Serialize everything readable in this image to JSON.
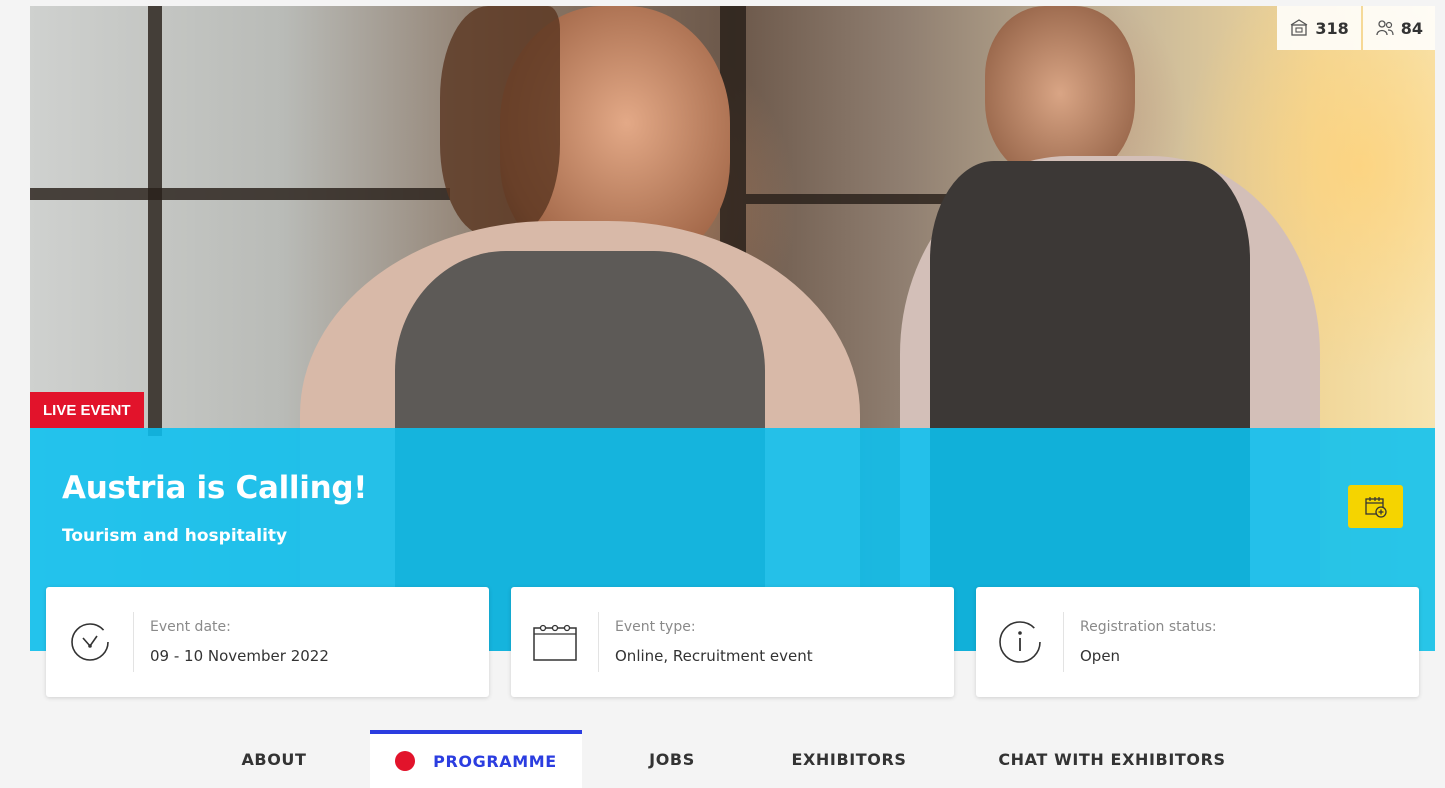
{
  "hero": {
    "counts": [
      {
        "icon": "exhibitor-icon",
        "value": "318"
      },
      {
        "icon": "visitors-icon",
        "value": "84"
      }
    ],
    "badge": "LIVE EVENT",
    "title": "Austria is Calling!",
    "subtitle": "Tourism and hospitality",
    "add_to_calendar_icon": "calendar-add-icon"
  },
  "info_cards": [
    {
      "icon": "clock-icon",
      "label": "Event date:",
      "value": "09 - 10 November 2022"
    },
    {
      "icon": "calendar-icon",
      "label": "Event type:",
      "value": "Online, Recruitment event"
    },
    {
      "icon": "info-icon",
      "label": "Registration status:",
      "value": "Open"
    }
  ],
  "tabs": [
    {
      "label": "ABOUT",
      "active": false
    },
    {
      "label": "PROGRAMME",
      "active": true,
      "live_indicator": true
    },
    {
      "label": "JOBS",
      "active": false
    },
    {
      "label": "EXHIBITORS",
      "active": false
    },
    {
      "label": "CHAT WITH EXHIBITORS",
      "active": false
    }
  ],
  "colors": {
    "band": "#0bc0f0",
    "live_badge": "#e2132b",
    "active_tab": "#2b3de0",
    "calendar_button": "#f5d400"
  }
}
